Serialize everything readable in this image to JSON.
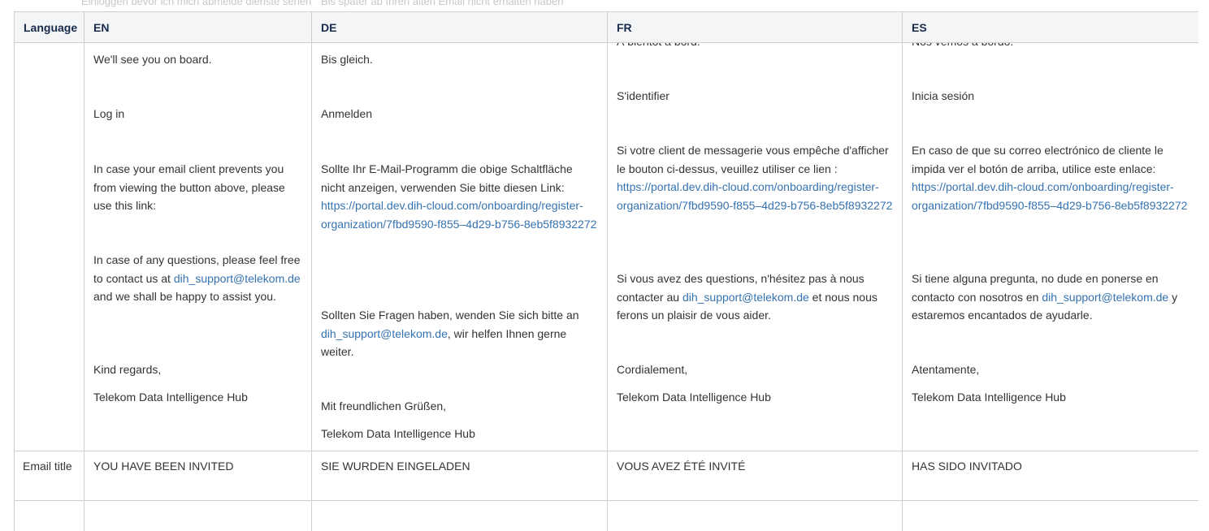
{
  "headers": {
    "language": "Language",
    "en": "EN",
    "de": "DE",
    "fr": "FR",
    "es": "ES"
  },
  "ghost_text": {
    "left": "Einloggen bevor ich mich abmelde dienste sehen",
    "right": "Bis später ab Ihren alten Email nicht erhalten haben"
  },
  "body_row": {
    "en": {
      "see_you": "We'll see you on board.",
      "login": "Log in",
      "link_intro": "In case your email client prevents you from viewing the button above, please use this link:",
      "questions_pre": "In case of any questions, please feel free to contact us at ",
      "email": "dih_support@telekom.de",
      "questions_post": " and we shall be happy to assist you.",
      "regards": "Kind regards,",
      "signature": "Telekom Data Intelligence Hub"
    },
    "de": {
      "see_you": "Bis gleich.",
      "login": "Anmelden",
      "link_intro": "Sollte Ihr E-Mail-Programm die obige Schaltfläche nicht anzeigen, verwenden Sie bitte diesen Link: ",
      "link_url": "https://portal.dev.dih-cloud.com/onboarding/register-organization/7fbd9590-f855–4d29-b756-8eb5f8932272",
      "questions_pre": "Sollten Sie Fragen haben, wenden Sie sich bitte an ",
      "email": "dih_support@telekom.de",
      "questions_post": ", wir helfen Ihnen gerne weiter.",
      "regards": "Mit freundlichen Grüßen,",
      "signature": "Telekom Data Intelligence Hub"
    },
    "fr": {
      "see_you": "À bientôt à bord.",
      "login": "S'identifier",
      "link_intro": "Si votre client de messagerie vous empêche d'afficher le bouton ci-dessus, veuillez utiliser ce lien : ",
      "link_url": "https://portal.dev.dih-cloud.com/onboarding/register-organization/7fbd9590-f855–4d29-b756-8eb5f8932272",
      "questions_pre": "Si vous avez des questions, n'hésitez pas à nous contacter au ",
      "email": "dih_support@telekom.de",
      "questions_post": " et nous nous ferons un plaisir de vous aider.",
      "regards": "Cordialement,",
      "signature": "Telekom Data Intelligence Hub"
    },
    "es": {
      "see_you": "Nos vemos a bordo.",
      "login": "Inicia sesión",
      "link_intro": "En caso de que su correo electrónico de cliente le impida ver el botón de arriba, utilice este enlace: ",
      "link_url": "https://portal.dev.dih-cloud.com/onboarding/register-organization/7fbd9590-f855–4d29-b756-8eb5f8932272",
      "questions_pre": "Si tiene alguna pregunta, no dude en ponerse en contacto con nosotros en ",
      "email": "dih_support@telekom.de",
      "questions_post": " y estaremos encantados de ayudarle.",
      "regards": "Atentamente,",
      "signature": "Telekom Data Intelligence Hub"
    }
  },
  "title_row": {
    "label": "Email title",
    "en": "YOU HAVE BEEN INVITED",
    "de": "SIE WURDEN EINGELADEN",
    "fr": "VOUS AVEZ ÉTÉ INVITÉ",
    "es": "HAS SIDO INVITADO"
  },
  "colors": {
    "link": "#3572b0",
    "header_bg": "#f4f5f7",
    "border": "#cfcfcf",
    "text": "#333333"
  }
}
